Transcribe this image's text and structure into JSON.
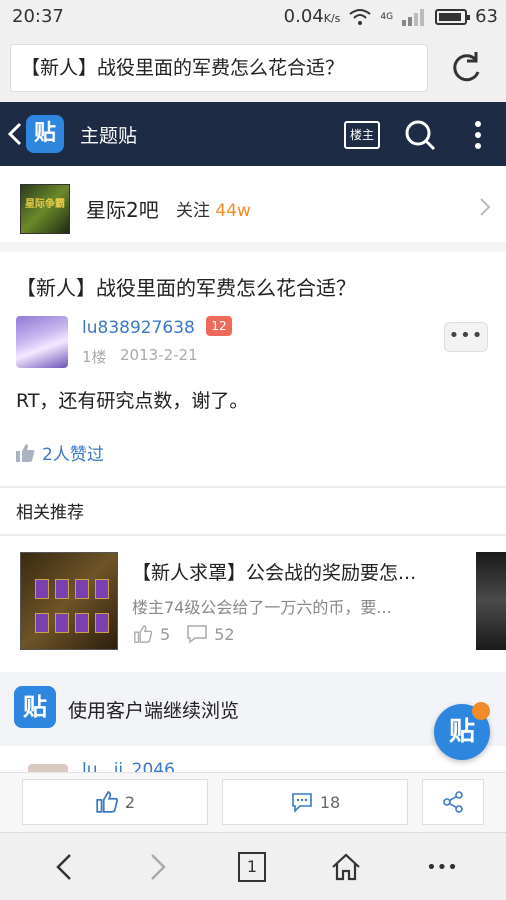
{
  "status_bar": {
    "time": "20:37",
    "net_speed": "0.04",
    "net_unit": "K/s",
    "net_type": "4G",
    "battery": "63"
  },
  "url_bar": {
    "title": "【新人】战役里面的军费怎么花合适？",
    "refresh_icon": "refresh-icon"
  },
  "header": {
    "logo_text": "贴",
    "title": "主题贴",
    "louzhu_label": "楼主"
  },
  "forum": {
    "avatar_text": "星际争霸",
    "name": "星际2吧",
    "follow_label": "关注",
    "follow_count": "44w"
  },
  "post": {
    "title": "【新人】战役里面的军费怎么花合适？",
    "author": "lu838927638",
    "level": "12",
    "floor": "1楼",
    "date": "2013-2-21",
    "more_label": "•••",
    "body": "RT，还有研究点数，谢了。",
    "likes": "2人赞过"
  },
  "related": {
    "heading": "相关推荐",
    "items": [
      {
        "title": "【新人求罩】公会战的奖励要怎...",
        "snippet": "楼主74级公会给了一万六的币，要...",
        "likes": "5",
        "comments": "52"
      }
    ]
  },
  "client_banner": {
    "logo_text": "贴",
    "text": "使用客户端继续浏览",
    "float_text": "贴"
  },
  "peek": {
    "name": "lu...ji_2046"
  },
  "action_bar": {
    "like_count": "2",
    "comment_count": "18"
  },
  "nav": {
    "tab_count": "1",
    "more_label": "•••"
  },
  "colors": {
    "header_bg": "#1e2b45",
    "accent": "#3a78c8",
    "brand": "#2e86de",
    "highlight": "#f08c2a",
    "badge": "#ef6a5a"
  }
}
